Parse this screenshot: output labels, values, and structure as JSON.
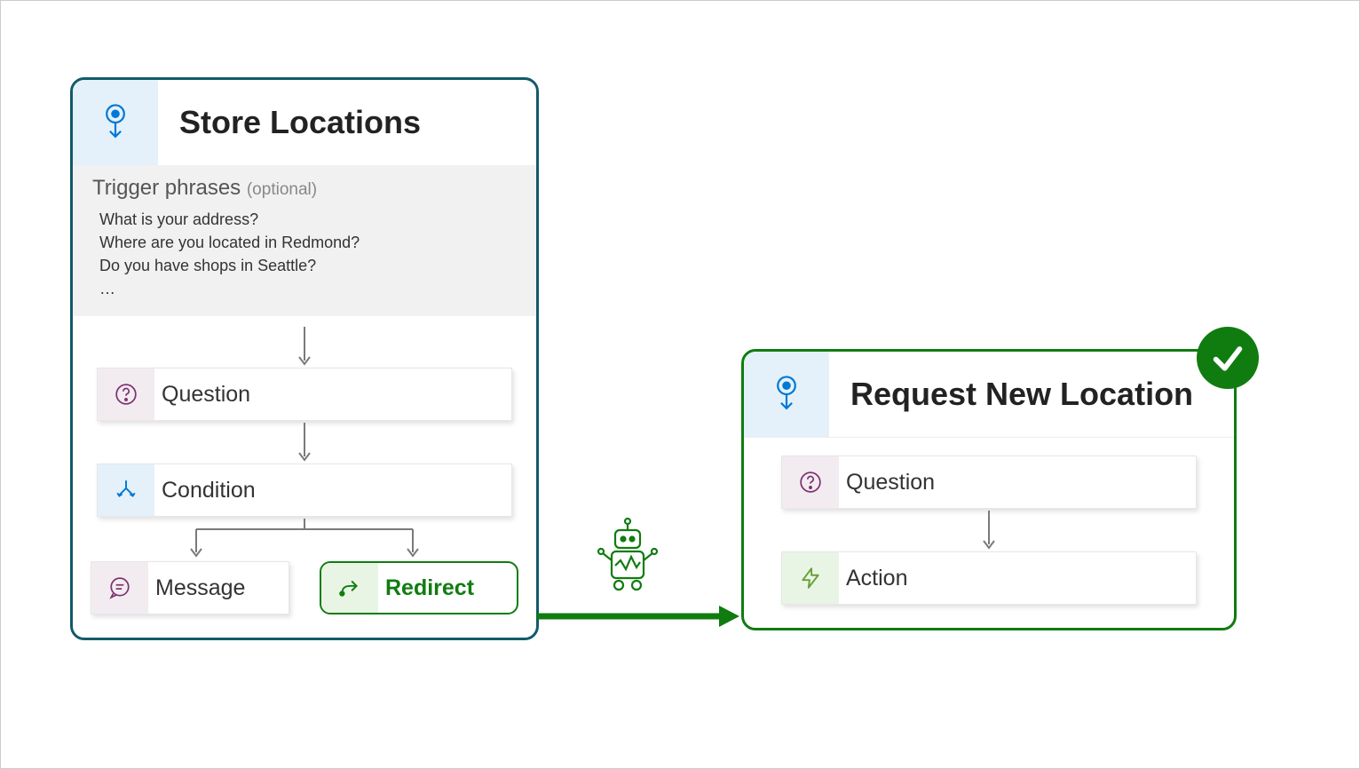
{
  "topic1": {
    "title": "Store Locations",
    "trigger_label": "Trigger phrases",
    "trigger_optional": "(optional)",
    "phrases": [
      "What is your address?",
      "Where are you located in Redmond?",
      "Do you have shops in Seattle?",
      "…"
    ],
    "nodes": {
      "question": "Question",
      "condition": "Condition",
      "message": "Message",
      "redirect": "Redirect"
    }
  },
  "topic2": {
    "title": "Request New Location",
    "nodes": {
      "question": "Question",
      "action": "Action"
    }
  },
  "icons": {
    "topic": "topic-icon",
    "question": "question-icon",
    "condition": "condition-icon",
    "message": "message-icon",
    "redirect": "redirect-icon",
    "action": "action-icon",
    "bot": "bot-icon",
    "check": "check-icon"
  }
}
